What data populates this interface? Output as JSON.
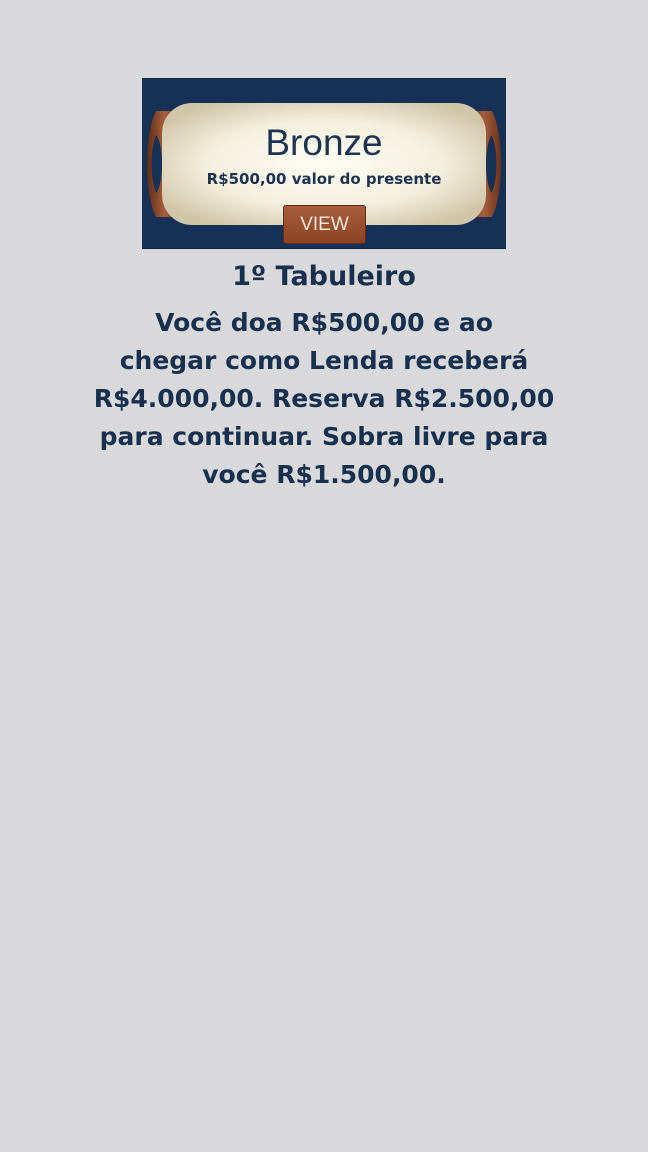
{
  "banner": {
    "title": "Bronze",
    "subtitle": "R$500,00 valor do presente",
    "button_label": "VIEW"
  },
  "heading": "1º Tabuleiro",
  "description_lines": [
    "Você doa R$500,00 e ao",
    "chegar como Lenda receberá",
    "R$4.000,00. Reserva R$2.500,00",
    "para continuar. Sobra livre para",
    "você R$1.500,00."
  ],
  "colors": {
    "background": "#d9d9db",
    "banner_navy": "#163056",
    "text_navy": "#17304f",
    "scroll_cream": "#f4efdf",
    "scroll_bronze": "#8b4a2b",
    "button_brown": "#9b5232"
  }
}
